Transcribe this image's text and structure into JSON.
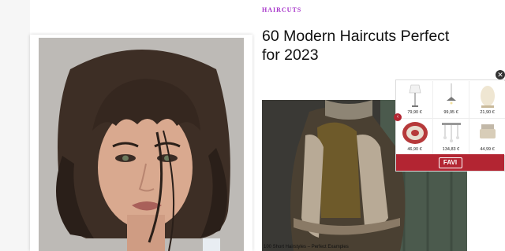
{
  "article": {
    "category": "HAIRCUTS",
    "title": "60 Modern Haircuts Perfect for 2023"
  },
  "video": {
    "caption": "100 Short Hairstyles – Perfect Examples"
  },
  "ad": {
    "brand": "FAVI",
    "close_symbol": "✕",
    "prev_symbol": "‹",
    "products": [
      {
        "icon": "table-lamp-icon",
        "price": "79,90 €"
      },
      {
        "icon": "pendant-lamp-icon",
        "price": "99,95 €"
      },
      {
        "icon": "floor-lamp-icon",
        "price": "21,90 €"
      },
      {
        "icon": "rug-icon",
        "price": "46,90 €"
      },
      {
        "icon": "chandelier-icon",
        "price": "134,83 €"
      },
      {
        "icon": "ceiling-light-icon",
        "price": "44,99 €"
      }
    ]
  },
  "colors": {
    "category": "#a531c9",
    "ad_bar": "#b32532"
  }
}
